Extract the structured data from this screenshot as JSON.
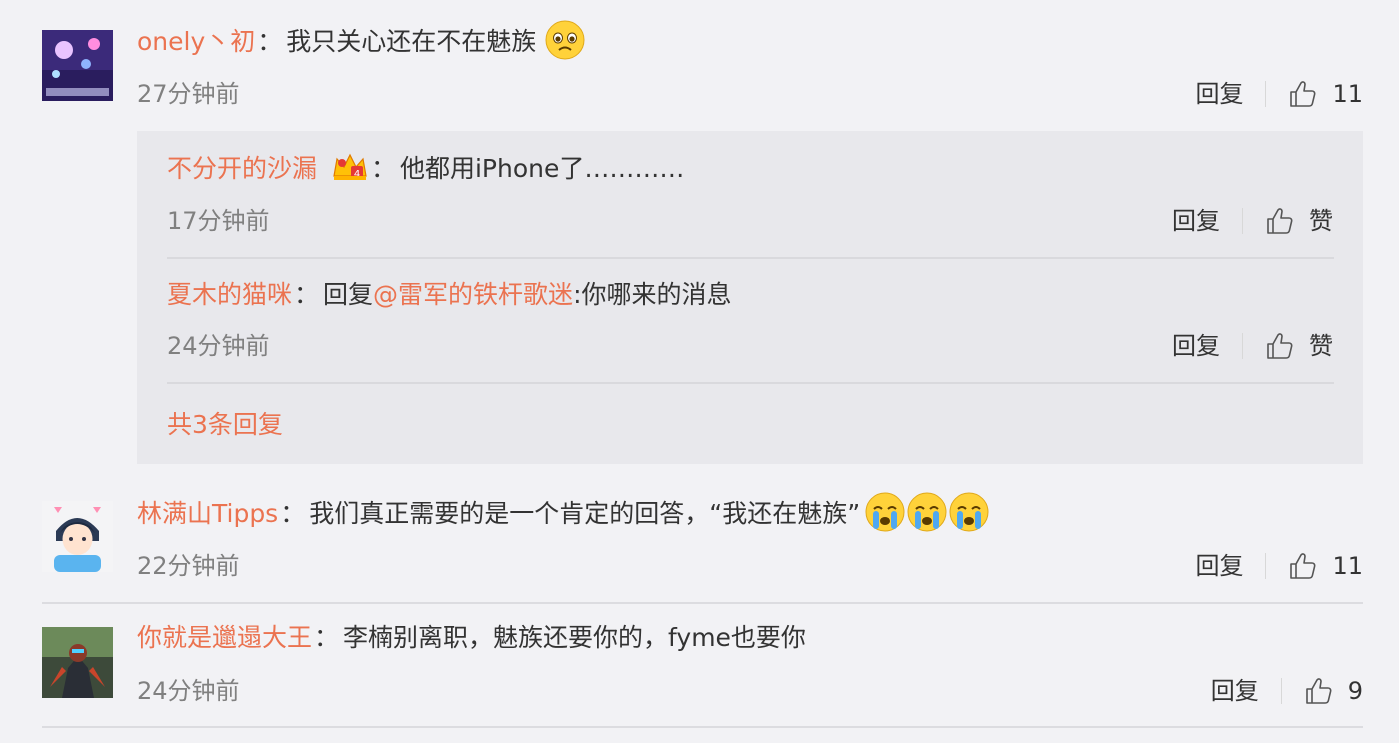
{
  "comments": [
    {
      "username": "onely丶初",
      "text": "我只关心还在不在魅族",
      "time": "27分钟前",
      "reply_label": "回复",
      "like_count": "11",
      "emoji": "sad-face-emoji"
    },
    {
      "username": "林满山Tipps",
      "text": "我们真正需要的是一个肯定的回答，“我还在魅族”",
      "time": "22分钟前",
      "reply_label": "回复",
      "like_count": "11",
      "emoji": "crying-face-emoji"
    },
    {
      "username": "你就是邋遢大王",
      "text": "李楠别离职，魅族还要你的，fyme也要你",
      "time": "24分钟前",
      "reply_label": "回复",
      "like_count": "9"
    }
  ],
  "replies": [
    {
      "username": "不分开的沙漏",
      "text": "他都用iPhone了…………",
      "time": "17分钟前",
      "reply_label": "回复",
      "like_label": "赞",
      "badge": "vip-crown-icon"
    },
    {
      "username": "夏木的猫咪",
      "prefix": "回复",
      "mention": "@雷军的铁杆歌迷",
      "text": ":你哪来的消息",
      "time": "24分钟前",
      "reply_label": "回复",
      "like_label": "赞"
    }
  ],
  "more_replies": "共3条回复",
  "colors": {
    "username": "#eb7350",
    "background": "#f2f2f5",
    "reply_box": "#e8e8ec"
  }
}
